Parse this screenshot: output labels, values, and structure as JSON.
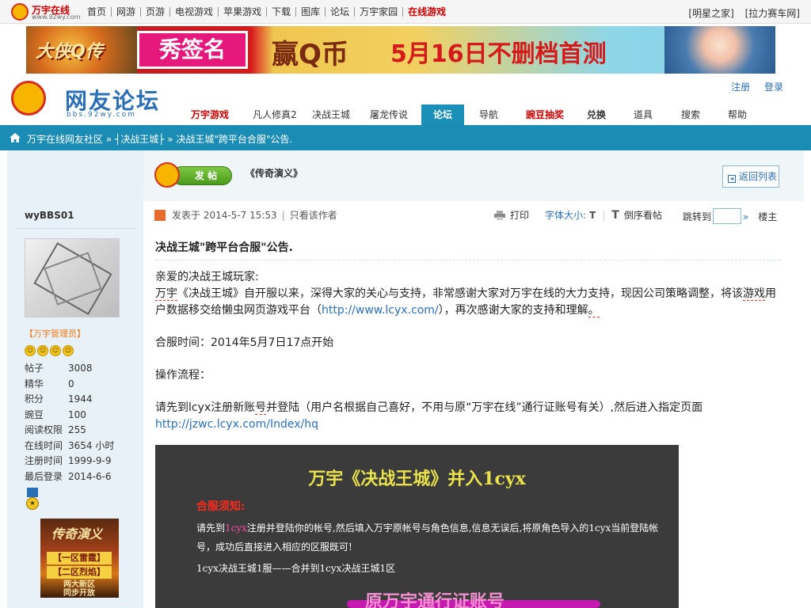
{
  "site": {
    "logo_text": "万宇在线",
    "logo_url_text": "www.92wy.com"
  },
  "topnav": {
    "items": [
      "首页",
      "网游",
      "页游",
      "电视游戏",
      "苹果游戏",
      "下载",
      "图库",
      "论坛",
      "万宇家园",
      "在线游戏"
    ],
    "right": [
      "[明星之家]",
      "[拉力赛车网]"
    ]
  },
  "banner": {
    "game_name": "大侠Q传",
    "sign_text": "秀签名",
    "q_text": "赢Q币",
    "date_text": "5月16日不删档首测"
  },
  "forum": {
    "title": "网友论坛",
    "url": "bbs.92wy.com",
    "login": "注册",
    "register": "登录"
  },
  "mainnav": {
    "items": [
      {
        "label": "万宇游戏",
        "style": "red"
      },
      {
        "label": "凡人修真2",
        "style": "normal"
      },
      {
        "label": "决战王城",
        "style": "normal"
      },
      {
        "label": "屠龙传说",
        "style": "normal"
      },
      {
        "label": "论坛",
        "style": "active"
      },
      {
        "label": "导航",
        "style": "normal"
      },
      {
        "label": "豌豆抽奖",
        "style": "red"
      },
      {
        "label": "兑换",
        "style": "dark"
      },
      {
        "label": "道具",
        "style": "normal"
      },
      {
        "label": "搜索",
        "style": "normal"
      },
      {
        "label": "帮助",
        "style": "normal"
      }
    ]
  },
  "breadcrumb": {
    "text": "万宇在线网友社区 » ┤决战王城├ » 决战王城\"跨平台合服\"公告."
  },
  "board": {
    "post_button": "发 帖",
    "title": "《传奇演义》",
    "back_label": "返回列表"
  },
  "user": {
    "name": "wyBBS01",
    "role": "【万宇管理员】",
    "stats": [
      {
        "k": "帖子",
        "v": "3008"
      },
      {
        "k": "精华",
        "v": "0"
      },
      {
        "k": "积分",
        "v": "1944"
      },
      {
        "k": "豌豆",
        "v": "100"
      },
      {
        "k": "阅读权限",
        "v": "255"
      },
      {
        "k": "在线时间",
        "v": "3654 小时"
      },
      {
        "k": "注册时间",
        "v": "1999-9-9"
      },
      {
        "k": "最后登录",
        "v": "2014-6-6"
      }
    ],
    "ad": {
      "title": "传奇演义",
      "line1": "【一区雷霆】",
      "line2": "【二区烈焰】",
      "line3": "两大新区",
      "line4": "同步开放"
    }
  },
  "post": {
    "meta": "发表于 2014-5-7 15:53",
    "only_author": "只看该作者",
    "print": "打印",
    "font_size": "字体大小:",
    "font_t": "T",
    "reverse": "倒序看帖",
    "jump_to": "跳转到",
    "jump_arrow": "»",
    "floor": "楼主",
    "title": "决战王城\"跨平台合服\"公告.",
    "greeting": "亲爱的决战王城玩家:",
    "para1_pre": "万宇",
    "para1_main": "《决战王城》自开服以来，深得大家的关心与支持，非常感谢大家对万宇在线的大力支持，现因公司策略调整，将该",
    "para1_game": "游戏",
    "para1_post": "用户数据移交给懒虫网页游戏平台（",
    "para1_link": "http://www.lcyx.com/",
    "para1_end": "），再次感谢大家的支持和理解",
    "para1_dot": "。",
    "merge_time": "合服时间：2014年5月7日17点开始",
    "process_label": "操作流程：",
    "step_pre": "请先到lcyx注册新账",
    "step_hao": "号",
    "step_post": "并登陆（用户名根据自己喜好，不用与原“万宇在线”通行证账号有关）,然后进入指定页面",
    "step_link": "http://jzwc.lcyx.com/Index/hq"
  },
  "notice_image": {
    "title": "万宇《决战王城》并入1cyx",
    "must_know": "合服须知:",
    "line1_pre": "请先到",
    "line1_pink": "1cyx",
    "line1_post": "注册并登陆你的帐号,然后填入万宇原帐号与角色信息,信息无误后,将原角色导入的1cyx当前登陆帐号，成功后直接进入相应的区服既可!",
    "line2": "1cyx决战王城1服——合并到1cyx决战王城1区",
    "bottom": "原万宇通行证账号"
  }
}
